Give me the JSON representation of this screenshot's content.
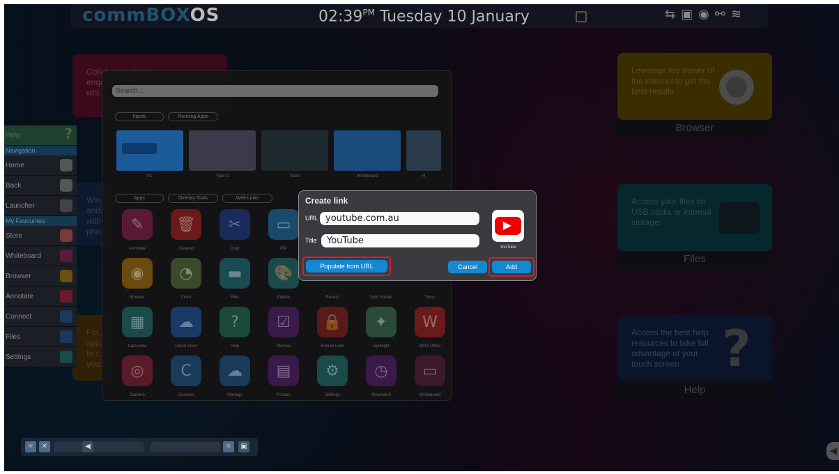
{
  "topbar": {
    "logo_main": "commBOX",
    "logo_os": "OS",
    "time": "02:39",
    "ampm": "PM",
    "date": "Tuesday 10 January",
    "status_icons": [
      "usb-icon",
      "copy-icon",
      "browser-icon",
      "network-icon",
      "wifi-icon"
    ]
  },
  "tiles": {
    "collaborate": "Collaborate, learn, engage with full... whi...",
    "win": "Win... and... with... pho...",
    "find": "Fin... app... to c... you...",
    "browser_text": "Leverage the power of the internet to get the best results",
    "browser_label": "Browser",
    "files_text": "Access your files on USB sticks or internal storage",
    "files_label": "Files",
    "help_text": "Access the best help resources to take full advantage of your touch screen",
    "help_label": "Help"
  },
  "sidebar": {
    "help": "Help",
    "navigation": "Navigation",
    "home": "Home",
    "back": "Back",
    "launcher": "Launcher",
    "my_favourites": "My Favourites",
    "store": "Store",
    "whiteboard": "Whiteboard",
    "browser": "Browser",
    "annotate": "Annotate",
    "connect": "Connect",
    "files": "Files",
    "settings": "Settings"
  },
  "launcher": {
    "search_placeholder": "Search...",
    "chips_top": [
      "Inputs",
      "Running Apps"
    ],
    "thumbs": [
      "PC",
      "Type-C",
      "Store",
      "Whiteboard",
      "H"
    ],
    "chips_apps": [
      "Apps",
      "Overlay Tools",
      "Web Links"
    ],
    "apps_row1": [
      "Annotate",
      "Cleanup",
      "Crop",
      "PIP"
    ],
    "apps_row2": [
      "Browser",
      "Clock",
      "Files",
      "Palette",
      "Record",
      "Split Screen",
      "Timer"
    ],
    "apps_row3": [
      "Calculator",
      "Cloud Drive",
      "Help",
      "Planner",
      "Screen Lock",
      "Spotlight",
      "WPS Office"
    ],
    "apps_row4": [
      "Camera",
      "Connect",
      "Manage",
      "Posters",
      "Settings",
      "Stopwatch",
      "Whiteboard"
    ]
  },
  "dialog": {
    "title": "Create link",
    "url_label": "URL",
    "url_value": "youtube.com.au",
    "title_label": "Title",
    "title_value": "YouTube",
    "icon_caption": "YouTube",
    "populate_button": "Populate from URL",
    "cancel_button": "Cancel",
    "add_button": "Add"
  },
  "colors": {
    "accent_blue": "#1588d4",
    "highlight_red": "#d02030",
    "youtube_red": "#ee0000"
  }
}
